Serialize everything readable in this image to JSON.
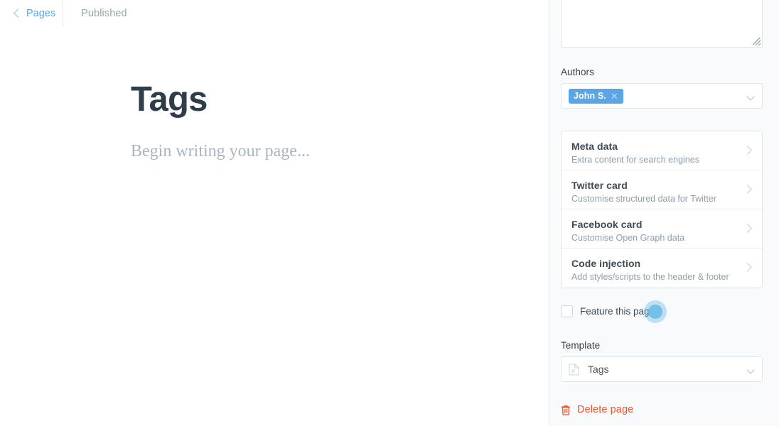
{
  "topbar": {
    "back_label": "Pages",
    "back_icon": "chevron-left-icon",
    "status_label": "Published"
  },
  "editor": {
    "title": "Tags",
    "body_placeholder": "Begin writing your page..."
  },
  "sidebar": {
    "excerpt": {
      "value": "",
      "resize_icon": "resize-grip-icon"
    },
    "authors": {
      "label": "Authors",
      "tokens": [
        {
          "label": "John S.",
          "remove_icon": "close-icon"
        }
      ],
      "chevron_icon": "chevron-down-icon"
    },
    "cards": [
      {
        "title": "Meta data",
        "subtitle": "Extra content for search engines",
        "chevron_icon": "chevron-right-icon"
      },
      {
        "title": "Twitter card",
        "subtitle": "Customise structured data for Twitter",
        "chevron_icon": "chevron-right-icon"
      },
      {
        "title": "Facebook card",
        "subtitle": "Customise Open Graph data",
        "chevron_icon": "chevron-right-icon"
      },
      {
        "title": "Code injection",
        "subtitle": "Add styles/scripts to the header & footer",
        "chevron_icon": "chevron-right-icon"
      }
    ],
    "feature": {
      "label": "Feature this page",
      "checked": false
    },
    "template": {
      "label": "Template",
      "value": "Tags",
      "icon": "document-icon",
      "chevron_icon": "chevron-down-icon"
    },
    "delete": {
      "label": "Delete page",
      "icon": "trash-icon"
    }
  },
  "cursor": {
    "indicator_icon": "click-indicator"
  },
  "colors": {
    "accent_blue": "#5ba4e5",
    "link_blue": "#5ba4e5",
    "danger_red": "#f05230",
    "title_dark": "#2e3d49",
    "muted_text": "#8fa0ac",
    "sidebar_bg": "#f9fafb",
    "border": "#dfe6eb"
  }
}
